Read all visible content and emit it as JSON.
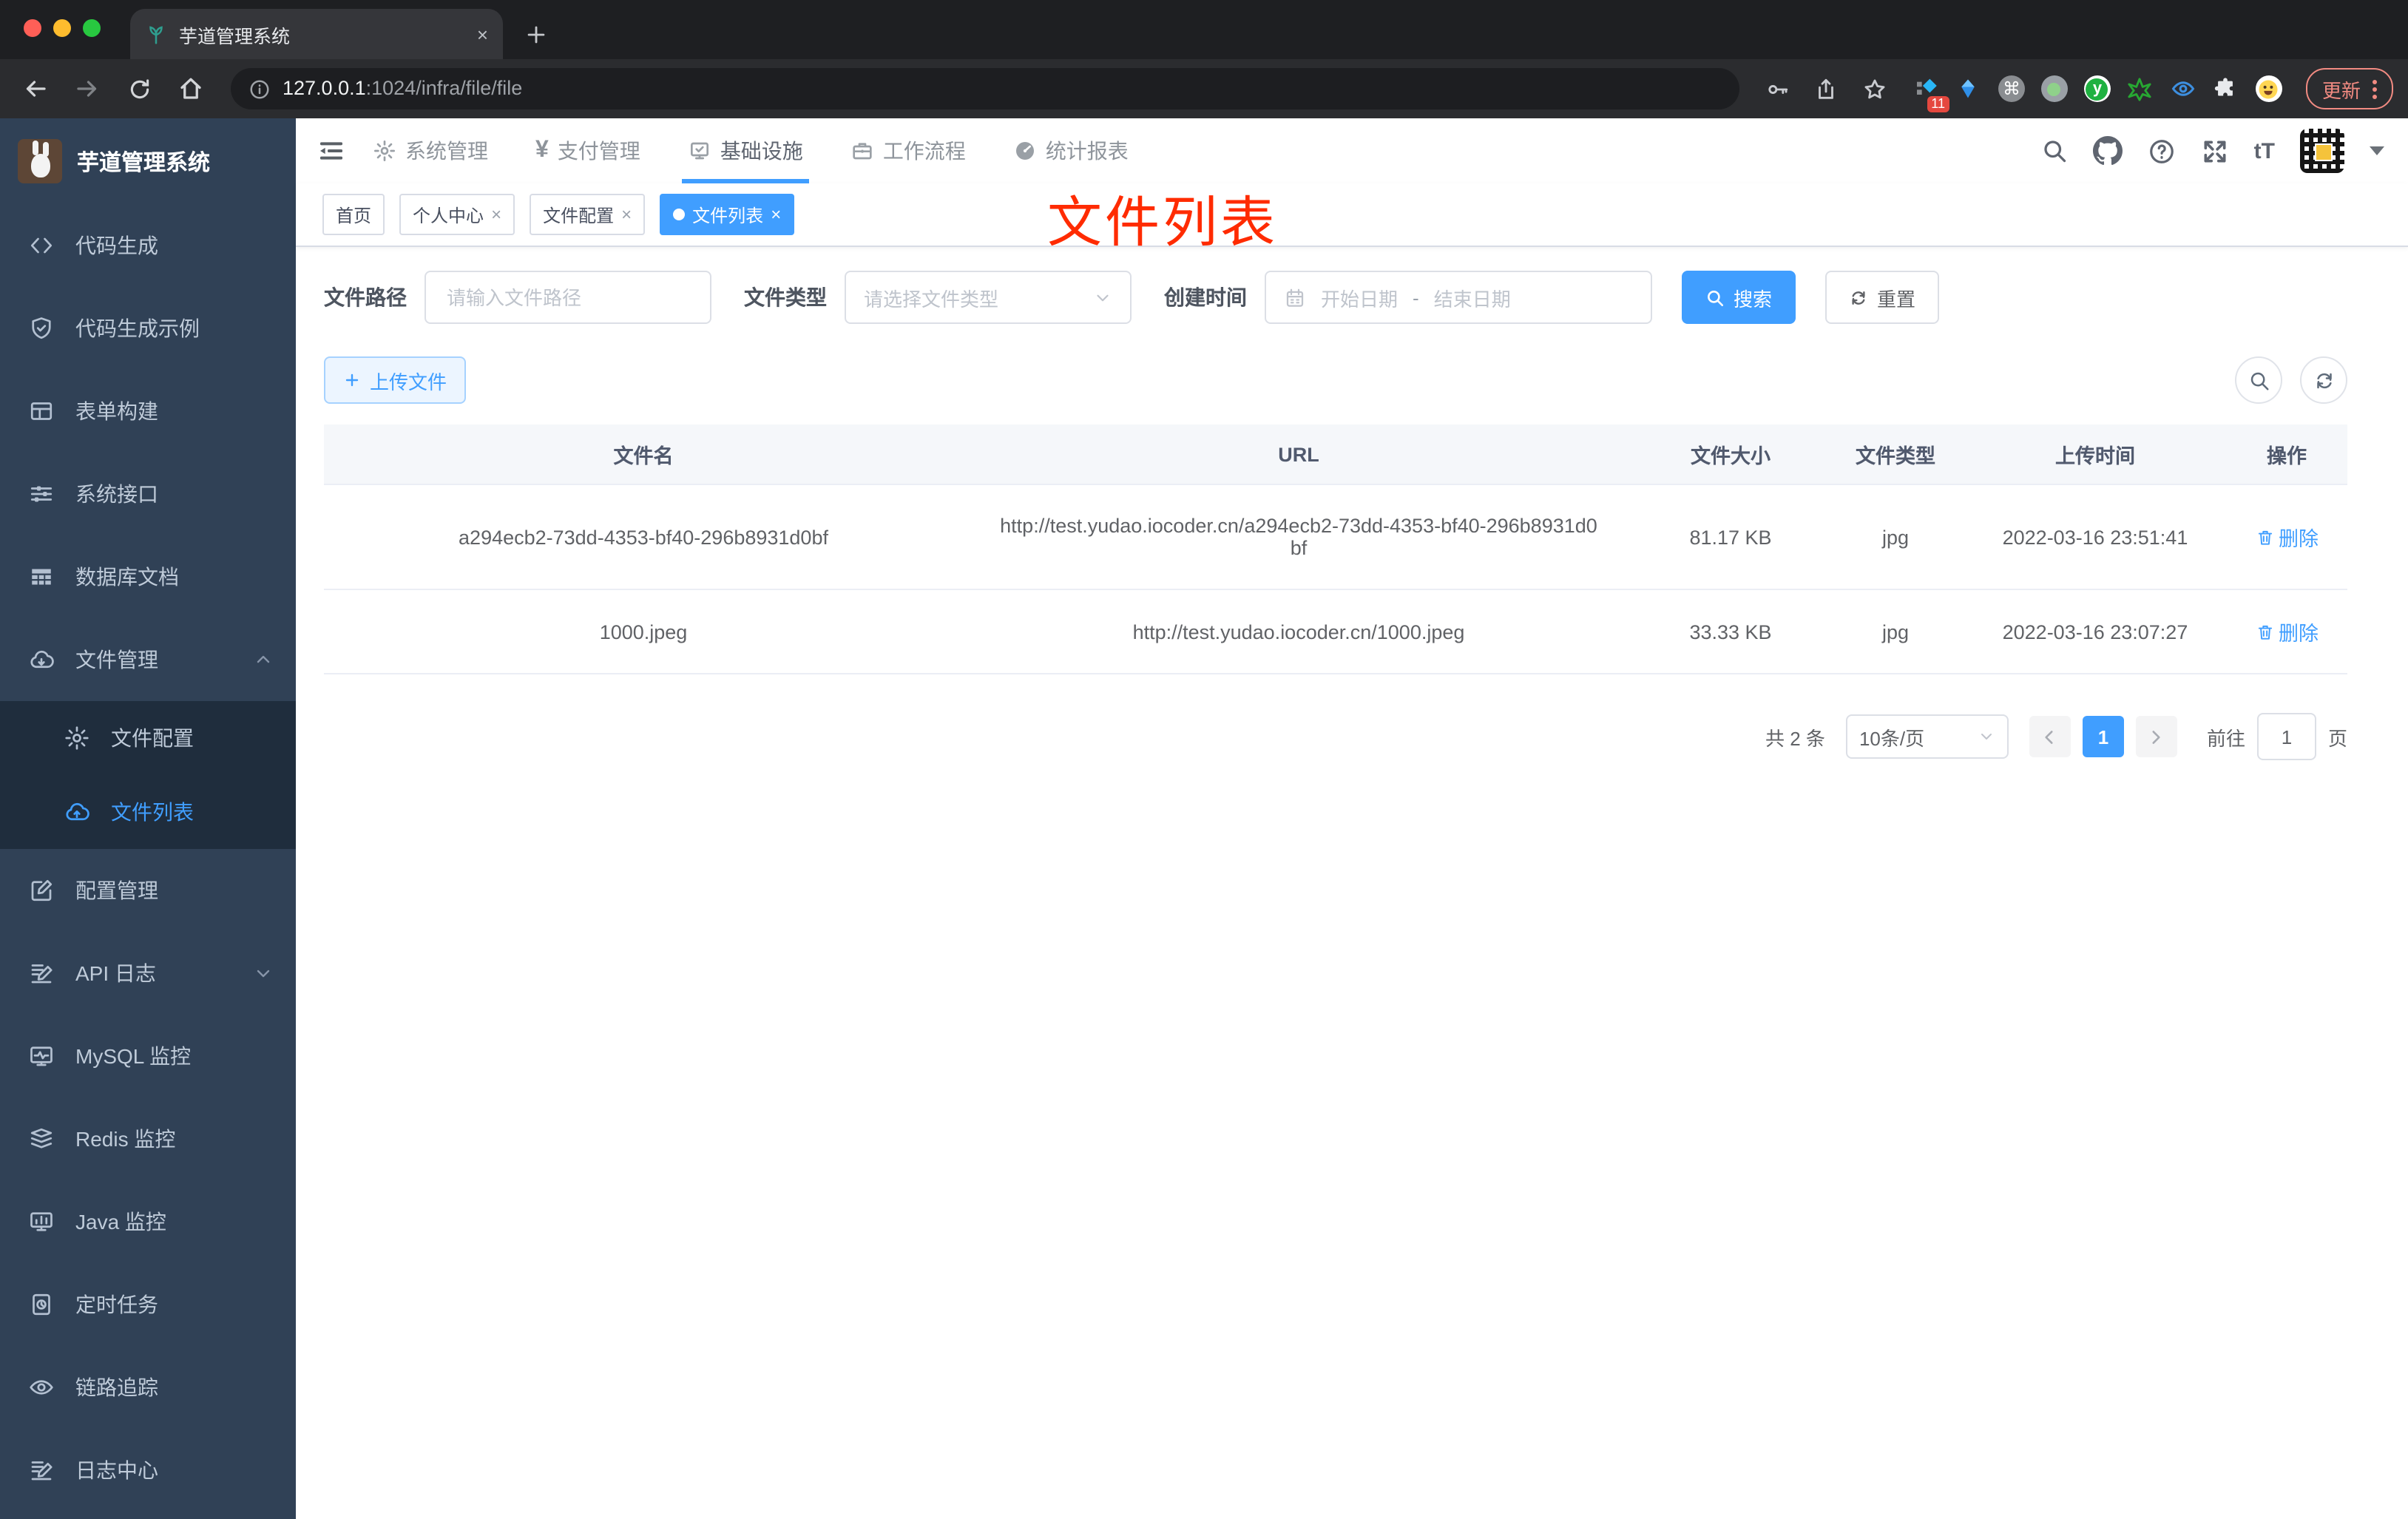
{
  "browser": {
    "tab_title": "芋道管理系统",
    "url_host": "127.0.0.1",
    "url_path": ":1024/infra/file/file",
    "update_label": "更新",
    "ext_badge": "11"
  },
  "ui": {
    "close_glyph": "×",
    "dash": "-",
    "font_size_icon": "tT",
    "yen_icon": "¥",
    "cmd_icon": "⌘",
    "y_icon": "y"
  },
  "sidebar": {
    "title": "芋道管理系统",
    "items": [
      {
        "label": "代码生成"
      },
      {
        "label": "代码生成示例"
      },
      {
        "label": "表单构建"
      },
      {
        "label": "系统接口"
      },
      {
        "label": "数据库文档"
      },
      {
        "label": "文件管理"
      },
      {
        "label": "文件配置"
      },
      {
        "label": "文件列表"
      },
      {
        "label": "配置管理"
      },
      {
        "label": "API 日志"
      },
      {
        "label": "MySQL 监控"
      },
      {
        "label": "Redis 监控"
      },
      {
        "label": "Java 监控"
      },
      {
        "label": "定时任务"
      },
      {
        "label": "链路追踪"
      },
      {
        "label": "日志中心"
      }
    ]
  },
  "nav": {
    "items": [
      {
        "label": "系统管理"
      },
      {
        "label": "支付管理"
      },
      {
        "label": "基础设施"
      },
      {
        "label": "工作流程"
      },
      {
        "label": "统计报表"
      }
    ]
  },
  "tags": {
    "items": [
      {
        "label": "首页"
      },
      {
        "label": "个人中心"
      },
      {
        "label": "文件配置"
      },
      {
        "label": "文件列表"
      }
    ]
  },
  "annotation": {
    "text": "文件列表"
  },
  "filters": {
    "path_label": "文件路径",
    "path_placeholder": "请输入文件路径",
    "type_label": "文件类型",
    "type_placeholder": "请选择文件类型",
    "date_label": "创建时间",
    "date_start": "开始日期",
    "date_end": "结束日期",
    "search_label": "搜索",
    "reset_label": "重置"
  },
  "toolbar": {
    "upload_label": "上传文件"
  },
  "table": {
    "columns": [
      "文件名",
      "URL",
      "文件大小",
      "文件类型",
      "上传时间",
      "操作"
    ],
    "delete_label": "删除",
    "rows": [
      {
        "name": "a294ecb2-73dd-4353-bf40-296b8931d0bf",
        "url": "http://test.yudao.iocoder.cn/a294ecb2-73dd-4353-bf40-296b8931d0bf",
        "size": "81.17 KB",
        "type": "jpg",
        "time": "2022-03-16 23:51:41"
      },
      {
        "name": "1000.jpeg",
        "url": "http://test.yudao.iocoder.cn/1000.jpeg",
        "size": "33.33 KB",
        "type": "jpg",
        "time": "2022-03-16 23:07:27"
      }
    ]
  },
  "pagination": {
    "total": "共 2 条",
    "page_size": "10条/页",
    "page": "1",
    "goto": "前往",
    "goto_value": "1",
    "unit": "页"
  },
  "colors": {
    "accent": "#409eff",
    "annotation_red": "#ff2b00",
    "sidebar_bg": "#304156",
    "submenu_bg": "#1f2d3d"
  }
}
